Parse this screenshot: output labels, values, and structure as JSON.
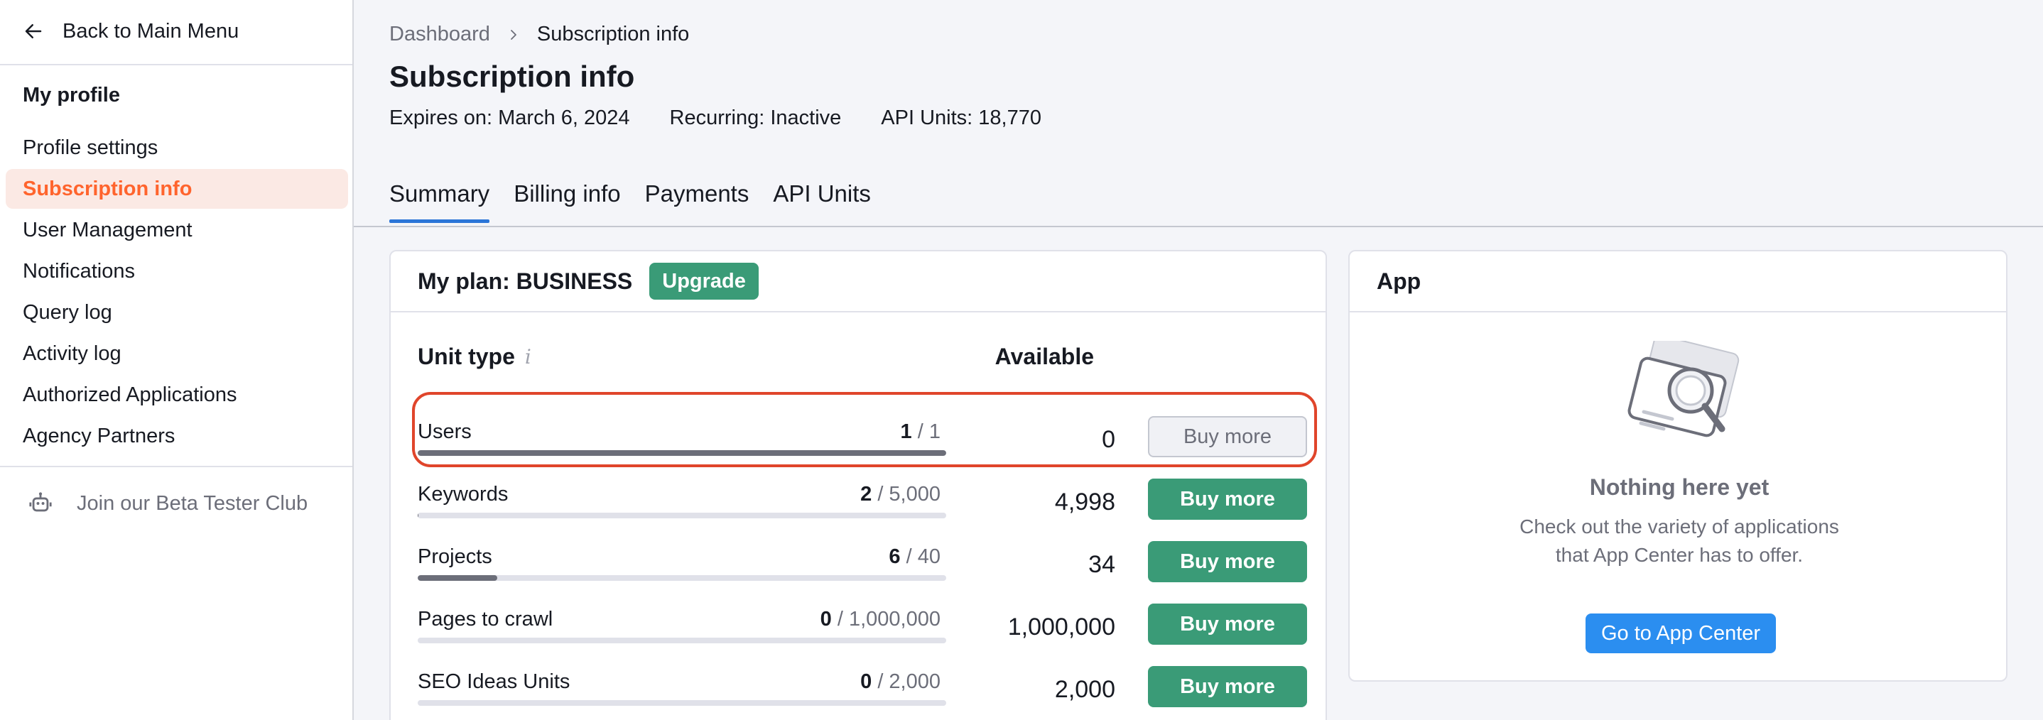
{
  "sidebar": {
    "back_label": "Back to Main Menu",
    "section_title": "My profile",
    "items": [
      {
        "label": "Profile settings"
      },
      {
        "label": "Subscription info"
      },
      {
        "label": "User Management"
      },
      {
        "label": "Notifications"
      },
      {
        "label": "Query log"
      },
      {
        "label": "Activity log"
      },
      {
        "label": "Authorized Applications"
      },
      {
        "label": "Agency Partners"
      }
    ],
    "active_index": 1,
    "beta_label": "Join our Beta Tester Club"
  },
  "breadcrumb": {
    "parent": "Dashboard",
    "current": "Subscription info"
  },
  "page": {
    "title": "Subscription info",
    "expires": "Expires on: March 6, 2024",
    "recurring": "Recurring: Inactive",
    "api_units": "API Units: 18,770"
  },
  "tabs": [
    {
      "label": "Summary"
    },
    {
      "label": "Billing info"
    },
    {
      "label": "Payments"
    },
    {
      "label": "API Units"
    }
  ],
  "plan": {
    "title": "My plan: BUSINESS",
    "upgrade_label": "Upgrade",
    "col_unit_type": "Unit type",
    "col_available": "Available",
    "info_icon": "i",
    "rows": [
      {
        "label": "Users",
        "used": "1",
        "total": "/ 1",
        "fraction": 1.0,
        "available": "0",
        "buy_label": "Buy more",
        "buy_enabled": false
      },
      {
        "label": "Keywords",
        "used": "2",
        "total": "/ 5,000",
        "fraction": 0.0004,
        "available": "4,998",
        "buy_label": "Buy more",
        "buy_enabled": true
      },
      {
        "label": "Projects",
        "used": "6",
        "total": "/ 40",
        "fraction": 0.15,
        "available": "34",
        "buy_label": "Buy more",
        "buy_enabled": true
      },
      {
        "label": "Pages to crawl",
        "used": "0",
        "total": "/ 1,000,000",
        "fraction": 0.0,
        "available": "1,000,000",
        "buy_label": "Buy more",
        "buy_enabled": true
      },
      {
        "label": "SEO Ideas Units",
        "used": "0",
        "total": "/ 2,000",
        "fraction": 0.0,
        "available": "2,000",
        "buy_label": "Buy more",
        "buy_enabled": true
      }
    ]
  },
  "app": {
    "title": "App",
    "empty_title": "Nothing here yet",
    "empty_line1": "Check out the variety of applications",
    "empty_line2": "that App Center has to offer.",
    "button_label": "Go to App Center"
  },
  "colors": {
    "accent": "#ff642d",
    "green": "#3a9b77",
    "blue": "#2b8ef0",
    "highlight": "#e0452b"
  }
}
